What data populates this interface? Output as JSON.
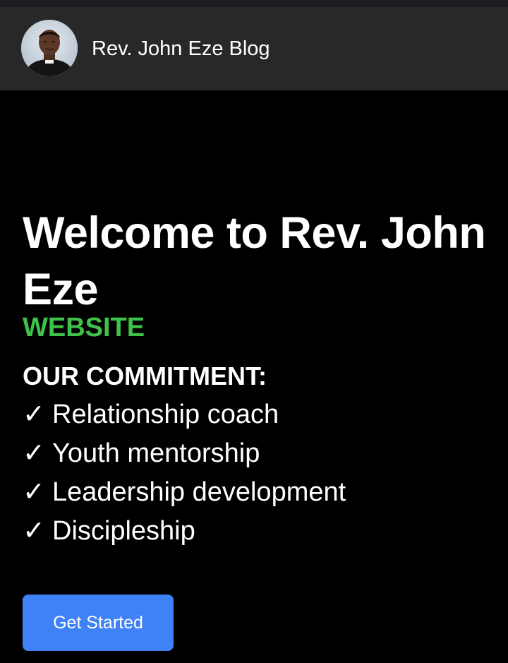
{
  "navbar": {
    "brand_title": "Rev. John Eze Blog",
    "avatar_icon": "portrait-photo"
  },
  "hero": {
    "title": "Welcome to Rev. John Eze",
    "tagline": "WEBSITE",
    "commitment_heading": "OUR COMMITMENT:",
    "check_glyph": "✓",
    "commitments": [
      "Relationship coach",
      "Youth mentorship",
      "Leadership development",
      "Discipleship"
    ],
    "cta_label": "Get Started"
  },
  "colors": {
    "page_background": "#000000",
    "navbar_background": "#282828",
    "tagline_green": "#3ec24a",
    "cta_blue": "#3f81f6",
    "text": "#ffffff"
  }
}
